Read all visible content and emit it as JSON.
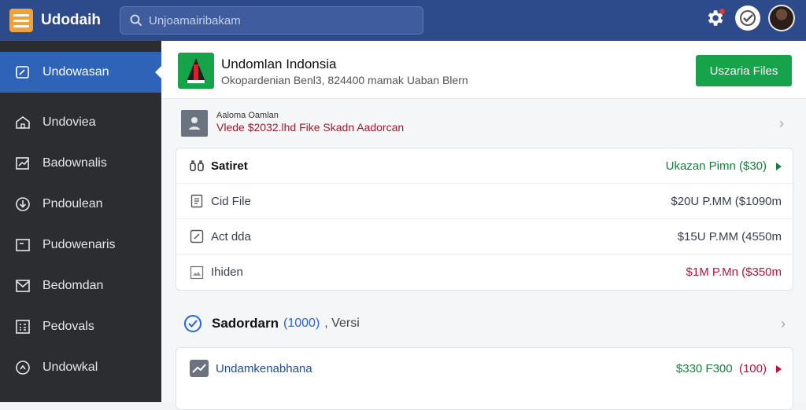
{
  "topbar": {
    "brand": "Udodaih",
    "search_placeholder": "Unjoamairibakam"
  },
  "sidebar": {
    "items": [
      {
        "label": "Undowasan",
        "icon": "edit-box-icon",
        "active": true
      },
      {
        "label": "Undoviea",
        "icon": "home-icon"
      },
      {
        "label": "Badownalis",
        "icon": "chart-box-icon"
      },
      {
        "label": "Pndoulean",
        "icon": "download-circle-icon"
      },
      {
        "label": "Pudowenaris",
        "icon": "window-icon"
      },
      {
        "label": "Bedomdan",
        "icon": "mail-icon"
      },
      {
        "label": "Pedovals",
        "icon": "grid-icon"
      },
      {
        "label": "Undowkal",
        "icon": "clock-icon"
      }
    ]
  },
  "header": {
    "title": "Undomlan Indonsia",
    "subtitle": "Okopardenian Benl3, 824400 mamak Uaban Blern",
    "action_label": "Uszaria Files"
  },
  "notice": {
    "line1": "Aaloma Oamlan",
    "line2": "Vlede $2032.lhd Fike  Skadn Aadorcan"
  },
  "details": {
    "header": {
      "label": "Satiret",
      "value": "Ukazan Pimn  ($30)"
    },
    "rows": [
      {
        "label": "Cid File",
        "value": "$20U P.MM  ($1090m",
        "icon": "document-icon",
        "tone": "normal"
      },
      {
        "label": "Act dda",
        "value": "$15U P.MM  (4550m",
        "icon": "pencil-box-icon",
        "tone": "normal"
      },
      {
        "label": "Ihiden",
        "value": "$1M P.Mn  ($350m",
        "icon": "image-icon",
        "tone": "red"
      }
    ]
  },
  "section": {
    "title": "Sadordarn",
    "count": "(1000)",
    "suffix": ", Versi"
  },
  "bottom_card": {
    "label": "Undamkenabhana",
    "value_green": "$330 F300",
    "value_red": "(100)"
  }
}
